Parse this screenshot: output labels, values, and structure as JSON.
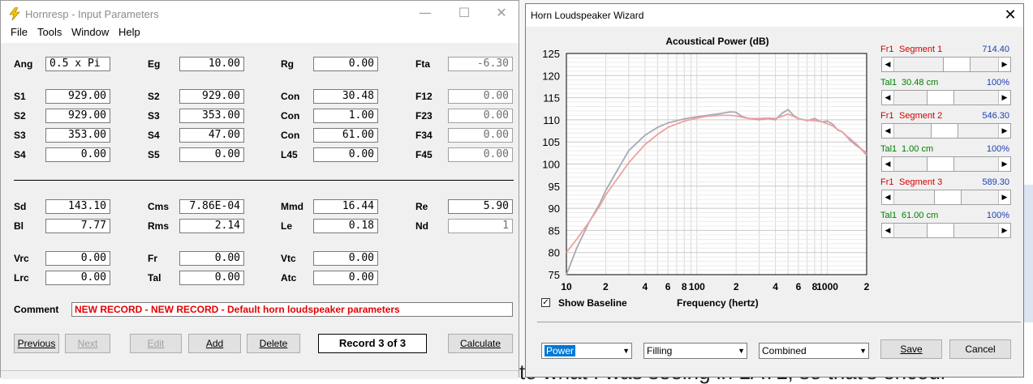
{
  "background": {
    "text": "to what I was seeing in LATL, so that's encour"
  },
  "win1": {
    "title": "Hornresp - Input Parameters",
    "menu": [
      "File",
      "Tools",
      "Window",
      "Help"
    ],
    "params": {
      "ang": {
        "label": "Ang",
        "value": "0.5 x Pi"
      },
      "eg": {
        "label": "Eg",
        "value": "10.00"
      },
      "rg": {
        "label": "Rg",
        "value": "0.00"
      },
      "fta": {
        "label": "Fta",
        "value": "-6.30"
      },
      "s1": {
        "label": "S1",
        "value": "929.00"
      },
      "s2a": {
        "label": "S2",
        "value": "929.00"
      },
      "con1": {
        "label": "Con",
        "value": "30.48"
      },
      "f12": {
        "label": "F12",
        "value": "0.00"
      },
      "s2b": {
        "label": "S2",
        "value": "929.00"
      },
      "s3a": {
        "label": "S3",
        "value": "353.00"
      },
      "con2": {
        "label": "Con",
        "value": "1.00"
      },
      "f23": {
        "label": "F23",
        "value": "0.00"
      },
      "s3b": {
        "label": "S3",
        "value": "353.00"
      },
      "s4a": {
        "label": "S4",
        "value": "47.00"
      },
      "con3": {
        "label": "Con",
        "value": "61.00"
      },
      "f34": {
        "label": "F34",
        "value": "0.00"
      },
      "s4b": {
        "label": "S4",
        "value": "0.00"
      },
      "s5": {
        "label": "S5",
        "value": "0.00"
      },
      "l45": {
        "label": "L45",
        "value": "0.00"
      },
      "f45": {
        "label": "F45",
        "value": "0.00"
      },
      "sd": {
        "label": "Sd",
        "value": "143.10"
      },
      "cms": {
        "label": "Cms",
        "value": "7.86E-04"
      },
      "mmd": {
        "label": "Mmd",
        "value": "16.44"
      },
      "re": {
        "label": "Re",
        "value": "5.90"
      },
      "bl": {
        "label": "Bl",
        "value": "7.77"
      },
      "rms": {
        "label": "Rms",
        "value": "2.14"
      },
      "le": {
        "label": "Le",
        "value": "0.18"
      },
      "nd": {
        "label": "Nd",
        "value": "1"
      },
      "vrc": {
        "label": "Vrc",
        "value": "0.00"
      },
      "fr": {
        "label": "Fr",
        "value": "0.00"
      },
      "vtc": {
        "label": "Vtc",
        "value": "0.00"
      },
      "lrc": {
        "label": "Lrc",
        "value": "0.00"
      },
      "tal": {
        "label": "Tal",
        "value": "0.00"
      },
      "atc": {
        "label": "Atc",
        "value": "0.00"
      }
    },
    "comment_label": "Comment",
    "comment_value": "NEW RECORD - NEW RECORD - Default horn loudspeaker parameters",
    "buttons": {
      "previous": "Previous",
      "next": "Next",
      "edit": "Edit",
      "add": "Add",
      "delete": "Delete",
      "calculate": "Calculate"
    },
    "record": "Record 3 of 3"
  },
  "win2": {
    "title": "Horn Loudspeaker Wizard",
    "segments": [
      {
        "fr_label": "Fr1",
        "seg_label": "Segment 1",
        "fr_value": "714.40",
        "tal_label": "Tal1",
        "tal_value": "30.48 cm",
        "tal_pct": "100%",
        "fr_pos": 0.62,
        "tal_pos": 0.42
      },
      {
        "fr_label": "Fr1",
        "seg_label": "Segment 2",
        "fr_value": "546.30",
        "tal_label": "Tal1",
        "tal_value": "1.00 cm",
        "tal_pct": "100%",
        "fr_pos": 0.47,
        "tal_pos": 0.42
      },
      {
        "fr_label": "Fr1",
        "seg_label": "Segment 3",
        "fr_value": "589.30",
        "tal_label": "Tal1",
        "tal_value": "61.00 cm",
        "tal_pct": "100%",
        "fr_pos": 0.51,
        "tal_pos": 0.42
      }
    ],
    "show_baseline": "Show Baseline",
    "show_baseline_checked": true,
    "dropdowns": [
      "Power",
      "Filling",
      "Combined"
    ],
    "buttons": {
      "save": "Save",
      "cancel": "Cancel"
    }
  },
  "chart_data": {
    "type": "line",
    "title": "Acoustical Power (dB)",
    "xlabel": "Frequency (hertz)",
    "ylabel": "",
    "x_scale": "log",
    "xlim": [
      10,
      2000
    ],
    "ylim": [
      75,
      125
    ],
    "x_ticks": [
      {
        "v": 10,
        "t": "10"
      },
      {
        "v": 20,
        "t": "2"
      },
      {
        "v": 40,
        "t": "4"
      },
      {
        "v": 60,
        "t": "6"
      },
      {
        "v": 80,
        "t": "8"
      },
      {
        "v": 100,
        "t": "100"
      },
      {
        "v": 200,
        "t": "2"
      },
      {
        "v": 400,
        "t": "4"
      },
      {
        "v": 600,
        "t": "6"
      },
      {
        "v": 800,
        "t": "8"
      },
      {
        "v": 1000,
        "t": "1000"
      },
      {
        "v": 2000,
        "t": "2"
      }
    ],
    "y_ticks": [
      75,
      80,
      85,
      90,
      95,
      100,
      105,
      110,
      115,
      120,
      125
    ],
    "grid": true,
    "series": [
      {
        "color": "#a9a9b6",
        "x": [
          10,
          12,
          15,
          18,
          20,
          25,
          30,
          40,
          50,
          60,
          80,
          100,
          120,
          150,
          180,
          200,
          220,
          250,
          300,
          350,
          400,
          450,
          500,
          550,
          600,
          700,
          800,
          900,
          1000,
          1100,
          1200,
          1300,
          1400,
          1500,
          1700,
          2000
        ],
        "y": [
          75,
          81,
          87,
          91,
          94,
          99,
          103,
          106.5,
          108.3,
          109.3,
          110.2,
          110.7,
          111.0,
          111.4,
          111.8,
          111.7,
          110.8,
          110.3,
          110.0,
          110.3,
          110.0,
          111.5,
          112.3,
          111.0,
          110.3,
          109.8,
          110.3,
          109.5,
          109.7,
          109.0,
          107.7,
          107.3,
          106.3,
          105.3,
          104.0,
          102.5
        ]
      },
      {
        "color": "#f0a0a0",
        "x": [
          10,
          12,
          15,
          18,
          20,
          25,
          30,
          40,
          50,
          60,
          80,
          100,
          120,
          150,
          180,
          200,
          220,
          250,
          300,
          350,
          400,
          450,
          500,
          550,
          600,
          700,
          800,
          900,
          1000,
          1100,
          1200,
          1300,
          1400,
          1500,
          1700,
          2000
        ],
        "y": [
          80,
          83,
          87,
          90.5,
          93,
          97,
          100.3,
          104.4,
          106.7,
          108.3,
          109.7,
          110.4,
          110.8,
          111.0,
          111.0,
          110.9,
          110.6,
          110.3,
          110.3,
          110.4,
          110.3,
          110.8,
          111.3,
          110.8,
          110.2,
          109.9,
          109.8,
          109.6,
          109.1,
          108.6,
          107.8,
          107.3,
          106.4,
          105.7,
          104.3,
          102.0
        ]
      }
    ]
  }
}
